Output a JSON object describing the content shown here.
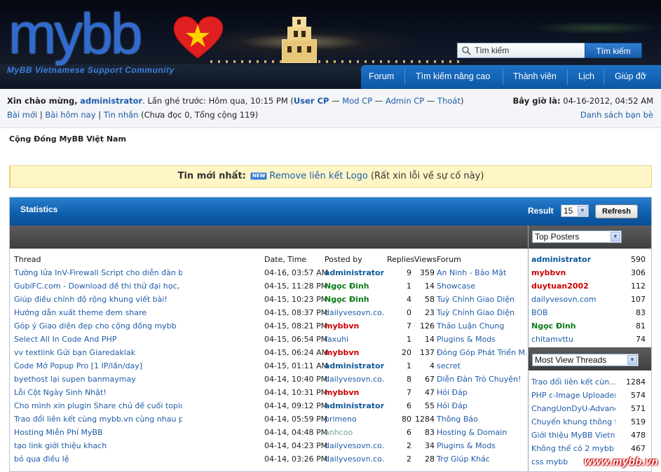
{
  "header": {
    "logo_text": "mybb",
    "logo_sub": "MyBB Vietnamese Support Community",
    "search_placeholder": "Tìm kiếm",
    "search_button": "Tìm kiếm",
    "nav": [
      "Forum",
      "Tìm kiếm nâng cao",
      "Thành viên",
      "Lịch",
      "Giúp đỡ"
    ]
  },
  "userbar": {
    "welcome": "Xin chào mừng,",
    "username": "administrator",
    "last_visit": ". Lần ghé trước: Hôm qua, 10:15 PM (",
    "links": [
      "User CP",
      "Mod CP",
      "Admin CP",
      "Thoát"
    ],
    "dash": "—",
    "close_paren": ")",
    "row2_links": [
      "Bài mới",
      "Bài hôm nay",
      "Tin nhắn"
    ],
    "pm_status": "(Chưa đọc 0, Tổng cộng 119)",
    "sep": "|",
    "now_label": "Bây giờ là:",
    "now_value": "04-16-2012, 04:52 AM",
    "buddy_list": "Danh sách bạn bè"
  },
  "breadcrumb": "Cộng Đồng MyBB Việt Nam",
  "announcement": {
    "label": "Tin mới nhất:",
    "badge": "NEW",
    "link": "Remove liên kết Logo",
    "note": "(Rất xin lỗi về sự cố này)"
  },
  "stats": {
    "title": "Statistics",
    "result_label": "Result",
    "result_value": "15",
    "refresh": "Refresh",
    "columns": [
      "Thread",
      "Date, Time",
      "Posted by",
      "Replies",
      "Views",
      "Forum"
    ],
    "rows": [
      {
        "thread": "Tường lửa InV-Firewall Script cho diễn đàn bạ...",
        "date": "04-16, 03:57 AM",
        "poster": "administrator",
        "ptype": "admin",
        "replies": "9",
        "views": "359",
        "forum": "An Ninh - Bảo Mật"
      },
      {
        "thread": "GubiFC.com - Download đề thi thử đại học, đề ...",
        "date": "04-15, 11:28 PM",
        "poster": "Ngọc Đinh",
        "ptype": "green",
        "replies": "1",
        "views": "14",
        "forum": "Showcase"
      },
      {
        "thread": "Giúp điều chỉnh độ rộng khung viết bài!",
        "date": "04-15, 10:23 PM",
        "poster": "Ngọc Đinh",
        "ptype": "green",
        "replies": "4",
        "views": "58",
        "forum": "Tuỳ Chỉnh Giao Diện"
      },
      {
        "thread": "Hướng dẫn xuất theme đem share",
        "date": "04-15, 08:37 PM",
        "poster": "dailyvesovn.co...",
        "ptype": "plain",
        "replies": "0",
        "views": "23",
        "forum": "Tuỳ Chỉnh Giao Diện"
      },
      {
        "thread": "Góp ý Giao diện đẹp cho cộng đồng mybb",
        "date": "04-15, 08:21 PM",
        "poster": "mybbvn",
        "ptype": "mod",
        "replies": "7",
        "views": "126",
        "forum": "Thảo Luận Chung"
      },
      {
        "thread": "Select All In Code And PHP",
        "date": "04-15, 06:54 PM",
        "poster": "faxuhi",
        "ptype": "plain",
        "replies": "1",
        "views": "14",
        "forum": "Plugins & Mods"
      },
      {
        "thread": "vv textlink Gửi bạn Giaredaklak",
        "date": "04-15, 06:24 AM",
        "poster": "mybbvn",
        "ptype": "mod",
        "replies": "20",
        "views": "137",
        "forum": "Đóng Góp Phát Triển M..."
      },
      {
        "thread": "Code Mở Popup Pro [1 IP/lần/day]",
        "date": "04-15, 01:11 AM",
        "poster": "administrator",
        "ptype": "admin",
        "replies": "1",
        "views": "4",
        "forum": "secret"
      },
      {
        "thread": "byethost lại supen banmaymay",
        "date": "04-14, 10:40 PM",
        "poster": "dailyvesovn.co...",
        "ptype": "plain",
        "replies": "8",
        "views": "67",
        "forum": "Diễn Đàn Trò Chuyện!"
      },
      {
        "thread": "Lỗi Cột Ngày Sinh Nhật!",
        "date": "04-14, 10:31 PM",
        "poster": "mybbvn",
        "ptype": "mod",
        "replies": "7",
        "views": "47",
        "forum": "Hỏi Đáp"
      },
      {
        "thread": "Cho mình xin plugin Share chủ đề cuối topic",
        "date": "04-14, 09:12 PM",
        "poster": "administrator",
        "ptype": "admin",
        "replies": "6",
        "views": "55",
        "forum": "Hỏi Đáp"
      },
      {
        "thread": "Trao đổi liên kết cùng mybb.vn cùng nhau phát...",
        "date": "04-14, 05:59 PM",
        "poster": "primeno",
        "ptype": "plain",
        "replies": "80",
        "views": "1284",
        "forum": "Thông Báo"
      },
      {
        "thread": "Hosting Miễn Phí MyBB",
        "date": "04-14, 04:48 PM",
        "poster": "anhcoo",
        "ptype": "grey",
        "replies": "6",
        "views": "83",
        "forum": "Hosting & Domain"
      },
      {
        "thread": "tạo link giới thiệu khach",
        "date": "04-14, 04:23 PM",
        "poster": "dailyvesovn.co...",
        "ptype": "plain",
        "replies": "2",
        "views": "34",
        "forum": "Plugins & Mods"
      },
      {
        "thread": "bỏ qua điều lệ",
        "date": "04-14, 03:26 PM",
        "poster": "dailyvesovn.co...",
        "ptype": "plain",
        "replies": "2",
        "views": "28",
        "forum": "Trợ Giúp Khác"
      }
    ],
    "top_posters_select": "Top Posters",
    "top_posters": [
      {
        "name": "administrator",
        "type": "admin",
        "count": "590"
      },
      {
        "name": "mybbvn",
        "type": "mod",
        "count": "306"
      },
      {
        "name": "duytuan2002",
        "type": "mod",
        "count": "112"
      },
      {
        "name": "dailyvesovn.com",
        "type": "plain",
        "count": "107"
      },
      {
        "name": "BOB",
        "type": "plain",
        "count": "83"
      },
      {
        "name": "Ngọc Đinh",
        "type": "green",
        "count": "81"
      },
      {
        "name": "chitamvttu",
        "type": "plain",
        "count": "74"
      }
    ],
    "most_view_select": "Most View Threads",
    "most_view": [
      {
        "name": "Trao đổi liên kết cùn...",
        "count": "1284"
      },
      {
        "name": "PHP c-Image Uploader ...",
        "count": "574"
      },
      {
        "name": "ChangUonDyU-Advanced ...",
        "count": "571"
      },
      {
        "name": "Chuyển khung thông ti...",
        "count": "519"
      },
      {
        "name": "Giới thiệu MyBB Vietn...",
        "count": "478"
      },
      {
        "name": "Không thể có 2 mybb",
        "count": "467"
      },
      {
        "name": "css mybb",
        "count": ""
      }
    ]
  },
  "watermark": "www.mybb.vn"
}
